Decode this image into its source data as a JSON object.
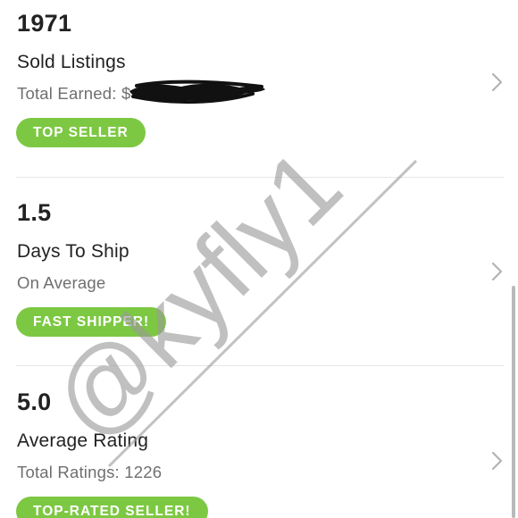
{
  "stats": [
    {
      "value": "1971",
      "title": "Sold Listings",
      "subtitle": "Total Earned: $",
      "badge": "TOP SELLER"
    },
    {
      "value": "1.5",
      "title": "Days To Ship",
      "subtitle": "On Average",
      "badge": "FAST SHIPPER!"
    },
    {
      "value": "5.0",
      "title": "Average Rating",
      "subtitle": "Total Ratings: 1226",
      "badge": "TOP-RATED SELLER!"
    }
  ],
  "watermark": {
    "text": "@kyfly1"
  },
  "icons": {
    "row_arrow": "chevron-right-icon"
  },
  "colors": {
    "badge_green": "#7dc843",
    "text_dark": "#222222",
    "text_muted": "#6f6f6f",
    "divider": "#e6e6e6",
    "watermark": "#9a9a9a",
    "redaction": "#111111"
  }
}
